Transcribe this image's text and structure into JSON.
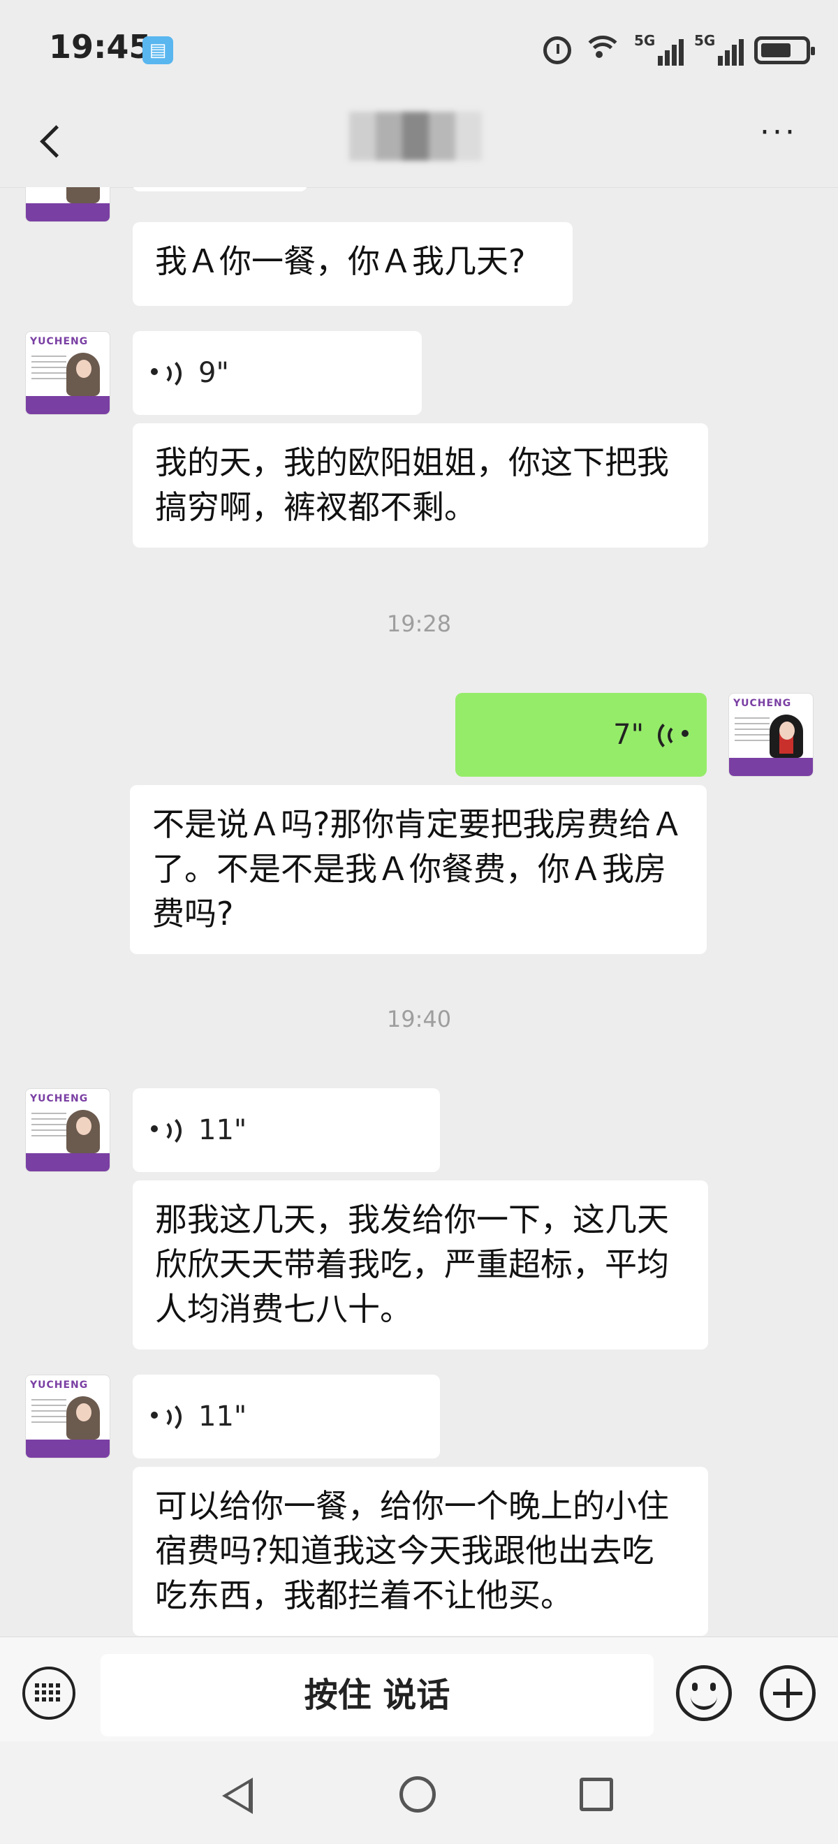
{
  "status_bar": {
    "time": "19:45",
    "network_1": "5G",
    "network_2": "5G",
    "sim_index": "6",
    "icons": [
      "book-icon",
      "alarm-icon",
      "wifi-icon",
      "signal-icon",
      "battery-icon"
    ]
  },
  "nav": {
    "title": "",
    "back_icon": "chevron-left-icon",
    "more_icon": "ellipsis-icon",
    "more_label": "···"
  },
  "messages": {
    "m1": "我Ａ你一餐，你Ａ我几天?",
    "m2_duration": "9\"",
    "m3": "我的天，我的欧阳姐姐，你这下把我搞穷啊，裤衩都不剩。",
    "ts1": "19:28",
    "m4_duration": "7\"",
    "m5": "不是说Ａ吗?那你肯定要把我房费给Ａ了。不是不是我Ａ你餐费，你Ａ我房费吗?",
    "ts2": "19:40",
    "m6_duration": "11\"",
    "m7": "那我这几天，我发给你一下，这几天欣欣天天带着我吃，严重超标，平均人均消费七八十。",
    "m8_duration": "11\"",
    "m9": "可以给你一餐，给你一个晚上的小住宿费吗?知道我这今天我跟他出去吃吃东西，我都拦着不让他买。"
  },
  "avatar_text": "YUCHENG",
  "input_bar": {
    "hold_to_talk": "按住 说话"
  },
  "colors": {
    "background": "#ededed",
    "sent_bubble": "#95ec69",
    "received_bubble": "#ffffff",
    "timestamp": "#9e9e9e"
  }
}
